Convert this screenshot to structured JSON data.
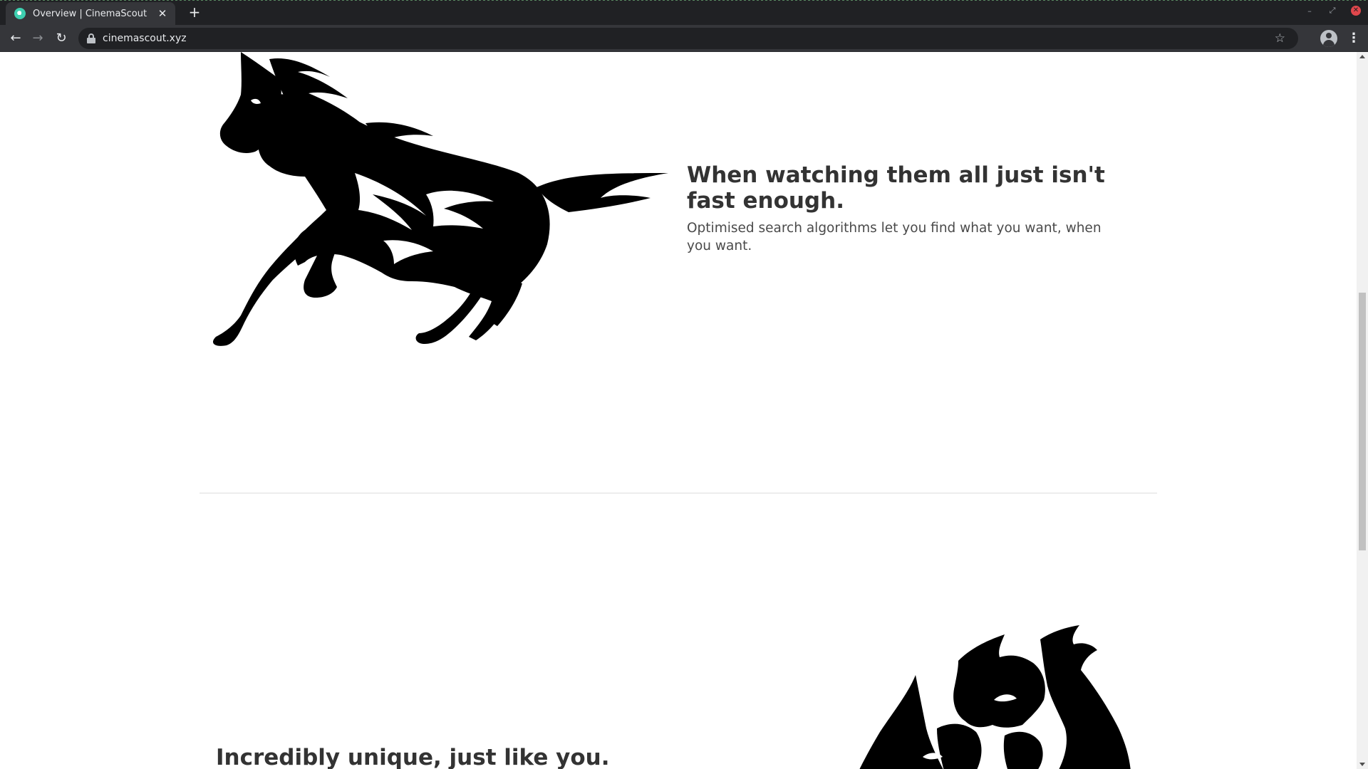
{
  "browser": {
    "tab": {
      "title": "Overview | CinemaScout",
      "close_glyph": "✕"
    },
    "new_tab_glyph": "+",
    "controls": {
      "minimize": "–",
      "restore": "⤢",
      "close": "✕"
    },
    "nav": {
      "back": "←",
      "forward": "→",
      "reload": "↻"
    },
    "address_bar": {
      "url": "cinemascout.xyz"
    },
    "star_glyph": "☆",
    "menu_glyph": "⋮"
  },
  "page": {
    "feature_1": {
      "heading": "When watching them all just isn't fast enough.",
      "description": "Optimised search algorithms let you find what you want, when you want."
    },
    "feature_2": {
      "heading": "Incredibly unique, just like you."
    }
  },
  "icons": {
    "favicon": "cinemascout-logo-icon",
    "lock": "lock-icon",
    "star": "star-icon",
    "profile": "profile-icon",
    "menu": "menu-icon"
  },
  "colors": {
    "chrome_dark": "#202124",
    "chrome_toolbar": "#35363a",
    "heading_text": "#333333",
    "body_text": "#4a4a4a",
    "illustration": "#000000",
    "close_button": "#e0474c"
  }
}
